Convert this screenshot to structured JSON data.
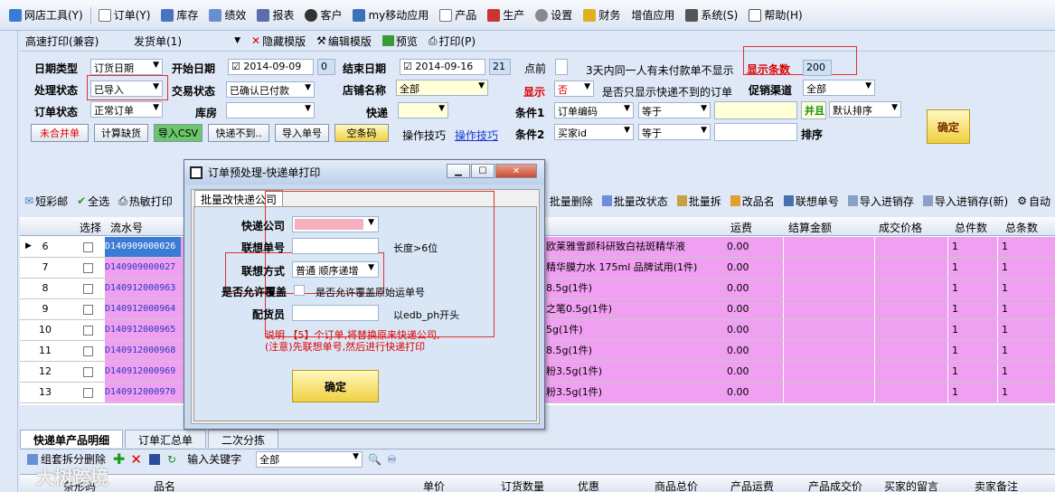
{
  "menubar": [
    "网店工具(Y)",
    "订单(Y)",
    "库存",
    "绩效",
    "报表",
    "客户",
    "my移动应用",
    "产品",
    "生产",
    "设置",
    "财务",
    "增值应用",
    "系统(S)",
    "帮助(H)"
  ],
  "toolbar2": {
    "print_mode": "高速打印(兼容)",
    "template": "发货单(1)",
    "hide_template": "隐藏模版",
    "edit_template": "编辑模版",
    "preview": "预览",
    "print": "打印(P)"
  },
  "filter": {
    "date_type_label": "日期类型",
    "date_type_value": "订货日期",
    "start_date_label": "开始日期",
    "start_date": "2014-09-09",
    "start_offset": "0",
    "end_date_label": "结束日期",
    "end_date": "2014-09-16",
    "end_offset": "21",
    "dot_before": "点前",
    "three_days_text": "3天内同一人有未付款单不显示",
    "show_count_label": "显示条数",
    "show_count_value": "200",
    "process_label": "处理状态",
    "process_value": "已导入",
    "trade_label": "交易状态",
    "trade_value": "已确认已付款",
    "shop_label": "店铺名称",
    "shop_value": "全部",
    "display_label": "显示",
    "display_value": "否",
    "express_only_text": "是否只显示快递不到的订单",
    "channel_label": "促销渠道",
    "channel_value": "全部",
    "order_status_label": "订单状态",
    "order_status_value": "正常订单",
    "warehouse_label": "库房",
    "express_label": "快递",
    "cond1_label": "条件1",
    "cond1_field": "订单编码",
    "cond1_op": "等于",
    "and_label": "并且",
    "sort_value": "默认排序",
    "cond2_label": "条件2",
    "cond2_field": "买家id",
    "cond2_op": "等于",
    "sort_label": "排序",
    "btn_unmerge": "未合并单",
    "btn_calc": "计算缺货",
    "btn_csv": "导入CSV",
    "btn_noexp": "快递不到..",
    "btn_import": "导入单号",
    "btn_empty": "空条码",
    "tips_label": "操作技巧",
    "tips_link": "操作技巧",
    "confirm": "确定"
  },
  "toolbar3": [
    "短彩邮",
    "全选",
    "热敏打印",
    "批量删除",
    "批量改状态",
    "批量拆",
    "改品名",
    "联想单号",
    "导入进销存",
    "导入进销存(新)",
    "自动"
  ],
  "grid": {
    "headers": [
      "选择",
      "流水号",
      "运费",
      "结算金额",
      "成交价格",
      "总件数",
      "总条数"
    ],
    "rows": [
      {
        "n": "6",
        "id": "D140909000026",
        "prod": "欧莱雅雪颜科研致白祛斑精华液",
        "fee": "0.00",
        "qty": "1",
        "cnt": "1"
      },
      {
        "n": "7",
        "id": "D140909000027",
        "prod": "精华膜力水 175ml 品牌试用(1件)",
        "fee": "0.00",
        "qty": "1",
        "cnt": "1"
      },
      {
        "n": "8",
        "id": "D140912000963",
        "prod": "8.5g(1件)",
        "fee": "0.00",
        "qty": "1",
        "cnt": "1"
      },
      {
        "n": "9",
        "id": "D140912000964",
        "prod": "之笔0.5g(1件)",
        "fee": "0.00",
        "qty": "1",
        "cnt": "1"
      },
      {
        "n": "10",
        "id": "D140912000965",
        "prod": "5g(1件)",
        "fee": "0.00",
        "qty": "1",
        "cnt": "1"
      },
      {
        "n": "11",
        "id": "D140912000968",
        "prod": "8.5g(1件)",
        "fee": "0.00",
        "qty": "1",
        "cnt": "1"
      },
      {
        "n": "12",
        "id": "D140912000969",
        "prod": "粉3.5g(1件)",
        "fee": "0.00",
        "qty": "1",
        "cnt": "1"
      },
      {
        "n": "13",
        "id": "D140912000970",
        "prod": "粉3.5g(1件)",
        "fee": "0.00",
        "qty": "1",
        "cnt": "1"
      }
    ]
  },
  "bottom": {
    "tabs": [
      "快递单产品明细",
      "订单汇总单",
      "二次分拣"
    ],
    "split_delete": "组套拆分删除",
    "keyword_label": "输入关键字",
    "keyword_value": "全部",
    "headers": [
      "条形码",
      "品名",
      "单价",
      "订货数量",
      "优惠",
      "商品总价",
      "产品运费",
      "产品成交价",
      "买家的留言",
      "卖家备注"
    ]
  },
  "dialog": {
    "title": "订单预处理-快递单打印",
    "tab": "批量改快递公司",
    "courier_label": "快递公司",
    "assoc_no_label": "联想单号",
    "assoc_no_hint": "长度>6位",
    "assoc_mode_label": "联想方式",
    "assoc_mode_value": "普通 顺序递增",
    "overwrite_label": "是否允许覆盖",
    "overwrite_text": "是否允许覆盖原始运单号",
    "picker_label": "配货员",
    "picker_hint": "以edb_ph开头",
    "note": "说明 【5】个订单,将替换原来快递公司,(注意)先联想单号,然后进行快递打印",
    "confirm": "确定"
  },
  "watermark": "大树跨境"
}
